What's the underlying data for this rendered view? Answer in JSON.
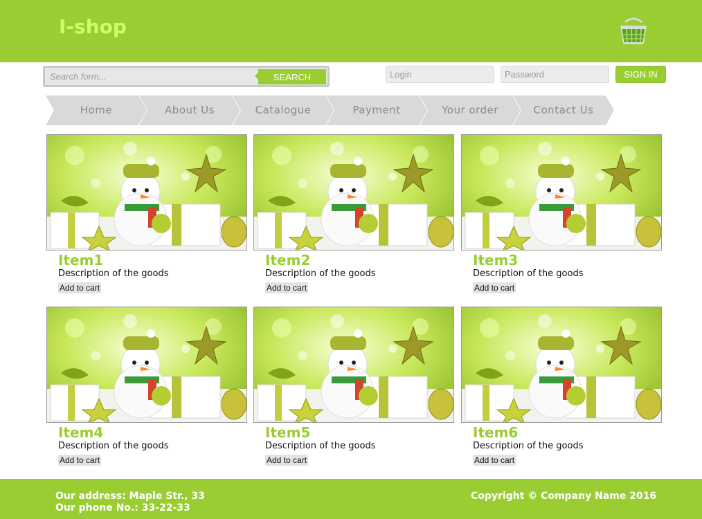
{
  "header": {
    "logo": "I-shop",
    "cart_icon": "shopping-basket-icon"
  },
  "search": {
    "placeholder": "Search form...",
    "button_label": "SEARCH"
  },
  "login": {
    "login_placeholder": "Login",
    "password_placeholder": "Password",
    "signin_label": "SIGN IN"
  },
  "nav": {
    "items": [
      {
        "label": "Home"
      },
      {
        "label": "About Us"
      },
      {
        "label": "Catalogue"
      },
      {
        "label": "Payment"
      },
      {
        "label": "Your order"
      },
      {
        "label": "Contact Us"
      }
    ]
  },
  "products": [
    {
      "title": "Item1",
      "description": "Description of the goods",
      "button": "Add to cart"
    },
    {
      "title": "Item2",
      "description": "Description of the goods",
      "button": "Add to cart"
    },
    {
      "title": "Item3",
      "description": "Description of the goods",
      "button": "Add to cart"
    },
    {
      "title": "Item4",
      "description": "Description of the goods",
      "button": "Add to cart"
    },
    {
      "title": "Item5",
      "description": "Description of the goods",
      "button": "Add to cart"
    },
    {
      "title": "Item6",
      "description": "Description of the goods",
      "button": "Add to cart"
    }
  ],
  "footer": {
    "address": "Our address: Maple Str., 33",
    "phone": "Our phone No.: 33-22-33",
    "copyright": "Copyright © Company Name 2016"
  },
  "colors": {
    "brand_green": "#9acd32",
    "logo_green": "#ccff66",
    "nav_gray": "#d9d9d9"
  }
}
